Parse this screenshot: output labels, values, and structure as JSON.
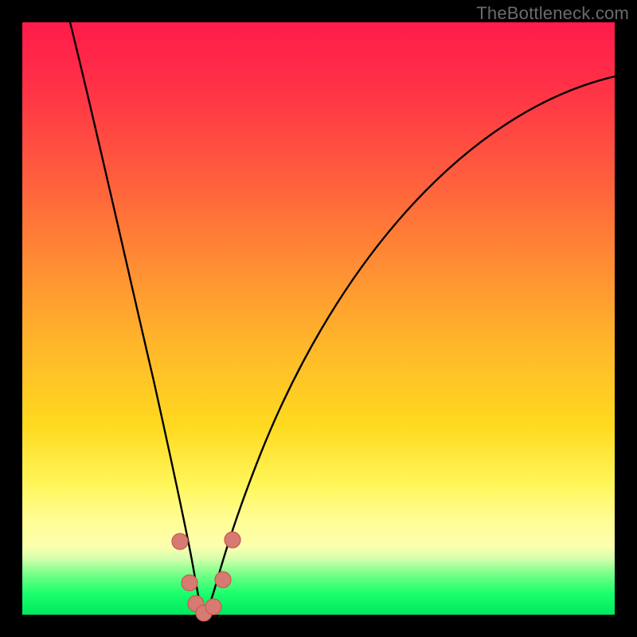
{
  "watermark": "TheBottleneck.com",
  "colors": {
    "frame": "#000000",
    "curve": "#000000",
    "dot_fill": "#d77b72",
    "dot_stroke": "#c45a50",
    "gradient_top": "#ff1b4a",
    "gradient_bottom": "#00e85f"
  },
  "chart_data": {
    "type": "line",
    "title": "",
    "xlabel": "",
    "ylabel": "",
    "xlim": [
      0,
      1
    ],
    "ylim": [
      0,
      1
    ],
    "x": [
      0.0,
      0.05,
      0.1,
      0.15,
      0.2,
      0.23,
      0.26,
      0.28,
      0.3,
      0.32,
      0.35,
      0.4,
      0.45,
      0.5,
      0.55,
      0.6,
      0.65,
      0.7,
      0.75,
      0.8,
      0.85,
      0.9,
      0.95,
      1.0
    ],
    "series": [
      {
        "name": "bottleneck-curve",
        "values": [
          1.0,
          0.83,
          0.66,
          0.495,
          0.32,
          0.19,
          0.08,
          0.015,
          0.0,
          0.01,
          0.07,
          0.22,
          0.355,
          0.465,
          0.555,
          0.63,
          0.695,
          0.745,
          0.785,
          0.823,
          0.852,
          0.876,
          0.893,
          0.906
        ]
      }
    ],
    "markers": {
      "name": "highlight-dots",
      "points": [
        {
          "x": 0.253,
          "y": 0.115,
          "r": 0.013
        },
        {
          "x": 0.27,
          "y": 0.047,
          "r": 0.013
        },
        {
          "x": 0.282,
          "y": 0.013,
          "r": 0.013
        },
        {
          "x": 0.3,
          "y": 0.0,
          "r": 0.013
        },
        {
          "x": 0.318,
          "y": 0.01,
          "r": 0.013
        },
        {
          "x": 0.335,
          "y": 0.055,
          "r": 0.013
        },
        {
          "x": 0.35,
          "y": 0.12,
          "r": 0.013
        }
      ]
    },
    "legend": null,
    "grid": false
  }
}
